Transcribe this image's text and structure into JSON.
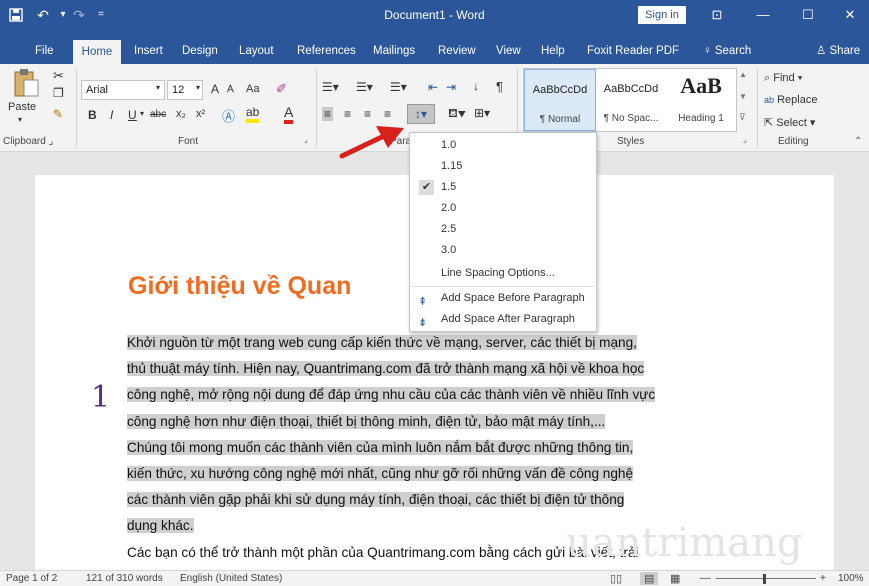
{
  "titlebar": {
    "title": "Document1  -  Word",
    "signin": "Sign in",
    "save_icon": "save-icon",
    "undo_glyph": "↶",
    "redo_glyph": "↷",
    "ribbon_display_glyph": "⊡",
    "minimize_glyph": "—",
    "maximize_glyph": "☐",
    "close_glyph": "✕"
  },
  "tabs": [
    {
      "label": "File"
    },
    {
      "label": "Home"
    },
    {
      "label": "Insert"
    },
    {
      "label": "Design"
    },
    {
      "label": "Layout"
    },
    {
      "label": "References"
    },
    {
      "label": "Mailings"
    },
    {
      "label": "Review"
    },
    {
      "label": "View"
    },
    {
      "label": "Help"
    },
    {
      "label": "Foxit Reader PDF"
    },
    {
      "label": "Search"
    },
    {
      "label": "Share"
    }
  ],
  "ribbon": {
    "clipboard": {
      "paste": "Paste",
      "label": "Clipboard"
    },
    "font": {
      "name": "Arial",
      "size": "12",
      "bold": "B",
      "italic": "I",
      "underline": "U",
      "strike": "abc",
      "subscript": "x₂",
      "superscript": "x²",
      "grow": "A",
      "shrink": "A",
      "case": "Aa",
      "clear": "✐",
      "label": "Font"
    },
    "paragraph": {
      "label": "Parag",
      "pilcrow": "¶",
      "sort": "↓"
    },
    "styles": {
      "label": "Styles",
      "items": [
        {
          "preview": "AaBbCcDd",
          "name": "¶ Normal"
        },
        {
          "preview": "AaBbCcDd",
          "name": "¶ No Spac..."
        },
        {
          "preview": "AaB",
          "name": "Heading 1"
        }
      ]
    },
    "editing": {
      "find": "Find",
      "replace": "Replace",
      "select": "Select",
      "label": "Editing"
    }
  },
  "line_spacing_menu": {
    "options": [
      "1.0",
      "1.15",
      "1.5",
      "2.0",
      "2.5",
      "3.0"
    ],
    "checked": "1.5",
    "more": "Line Spacing Options...",
    "before": "Add Space Before Paragraph",
    "after": "Add Space After Paragraph"
  },
  "document": {
    "heading": "Giới thiệu về Quan",
    "marker": "1",
    "lines": [
      "Khởi nguồn từ một trang web cung cấp kiến thức về mạng, server, các thiết bị mạng,",
      "thủ thuật máy tính. Hiện nay, Quantrimang.com đã trở thành mạng xã hội về khoa học",
      "công nghệ, mở rộng nội dung để đáp ứng nhu cầu của các thành viên về nhiều lĩnh vực",
      "công nghệ hơn như điện thoại, thiết bị thông minh, điện tử, bảo mật máy tính,...",
      "Chúng tôi mong muốn các thành viên của mình luôn nắm bắt được những thông tin,",
      "kiến thức, xu hướng công nghệ mới nhất, cũng như gỡ rối những vấn đề công nghệ",
      "các thành viên gặp phải khi sử dụng máy tính, điện thoại, các thiết bị điện tử thông",
      "dụng khác.",
      "Các bạn có thể trở thành một phần của Quantrimang.com bằng cách gửi bài viết, trải"
    ],
    "watermark": "uantrimang"
  },
  "statusbar": {
    "page": "Page 1 of 2",
    "words": "121 of 310 words",
    "language": "English (United States)",
    "zoom_minus": "—",
    "zoom_plus": "+",
    "zoom": "100%"
  },
  "colors": {
    "brand": "#2b579a",
    "heading": "#f26b21",
    "highlight": "#cfcfcf",
    "arrow": "#d9201b"
  }
}
